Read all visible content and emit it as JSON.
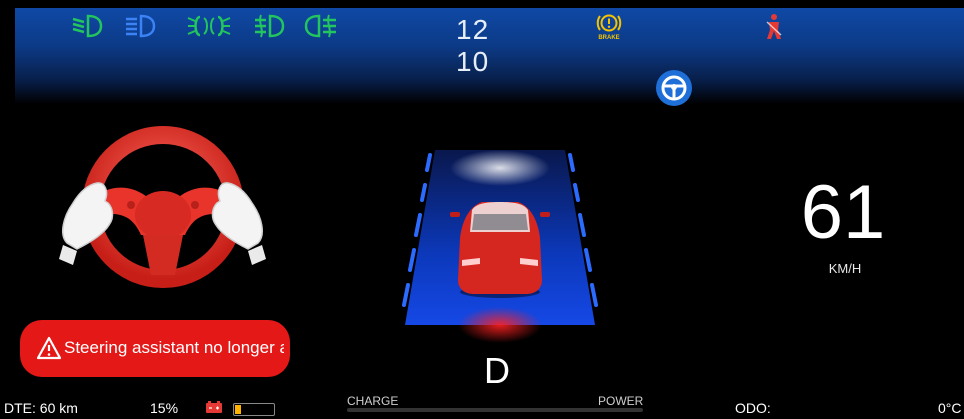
{
  "top_bar": {
    "time_hours": "12",
    "time_minutes": "10",
    "brake_label": "BRAKE",
    "icons": [
      "low-beam-icon",
      "high-beam-icon",
      "parking-lights-icon",
      "front-fog-icon",
      "rear-fog-icon",
      "brake-warning-icon",
      "seatbelt-warning-icon"
    ],
    "colors": {
      "lights_green": "#22c55e",
      "high_beam_blue": "#3b82f6",
      "brake_yellow": "#f5c400",
      "seatbelt_red": "#e53935"
    }
  },
  "autopilot": {
    "icon": "steering-wheel-icon",
    "color": "#1f6fd8"
  },
  "speed": {
    "value": "61",
    "unit": "KM/H"
  },
  "gear": "D",
  "alert": {
    "text": "Steering assistant no longer av",
    "icon": "warning-triangle-icon",
    "color": "#e51818"
  },
  "bottom_bar": {
    "dte": "DTE: 60 km",
    "battery_percent": "15%",
    "battery_level": 0.15,
    "charge_label": "CHARGE",
    "power_label": "POWER",
    "odo": "ODO:",
    "temperature": "0°C"
  }
}
